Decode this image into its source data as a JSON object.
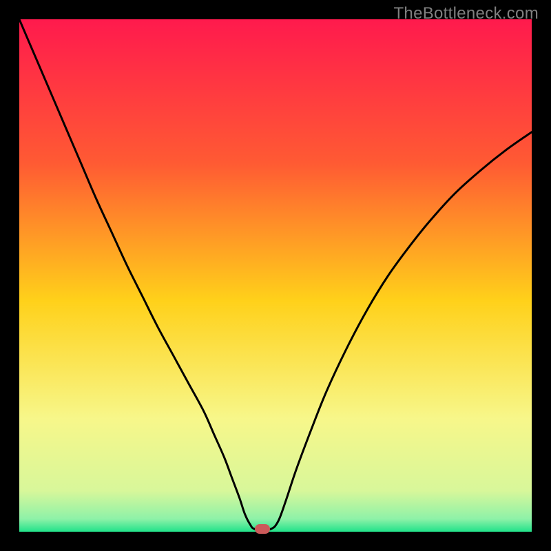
{
  "watermark": "TheBottleneck.com",
  "chart_data": {
    "type": "line",
    "title": "",
    "xlabel": "",
    "ylabel": "",
    "xlim": [
      0,
      100
    ],
    "ylim": [
      0,
      100
    ],
    "grid": false,
    "legend": false,
    "gradient_stops": [
      {
        "offset": 0.0,
        "color": "#ff1a4d"
      },
      {
        "offset": 0.28,
        "color": "#ff5a33"
      },
      {
        "offset": 0.55,
        "color": "#ffd11a"
      },
      {
        "offset": 0.78,
        "color": "#f7f78a"
      },
      {
        "offset": 0.92,
        "color": "#d8f79a"
      },
      {
        "offset": 0.975,
        "color": "#8ef2a8"
      },
      {
        "offset": 1.0,
        "color": "#21e28a"
      }
    ],
    "series": [
      {
        "name": "bottleneck-curve",
        "x": [
          0,
          3,
          6,
          9,
          12,
          15,
          18,
          21,
          24,
          27,
          30,
          33,
          36,
          38,
          40,
          41.5,
          43,
          44,
          45,
          46,
          49,
          50.5,
          52,
          54,
          57,
          60,
          64,
          68,
          72,
          76,
          80,
          85,
          90,
          95,
          100
        ],
        "y": [
          100,
          93,
          86,
          79,
          72,
          65,
          58.5,
          52,
          46,
          40,
          34.5,
          29,
          23.5,
          19,
          14.5,
          10.5,
          6.5,
          3.5,
          1.5,
          0.5,
          0.5,
          2,
          6,
          12,
          20,
          27.5,
          36,
          43.5,
          50,
          55.5,
          60.5,
          66,
          70.5,
          74.5,
          78
        ]
      }
    ],
    "marker": {
      "x": 47.5,
      "y": 0.5,
      "color": "#cc5a5a"
    }
  }
}
